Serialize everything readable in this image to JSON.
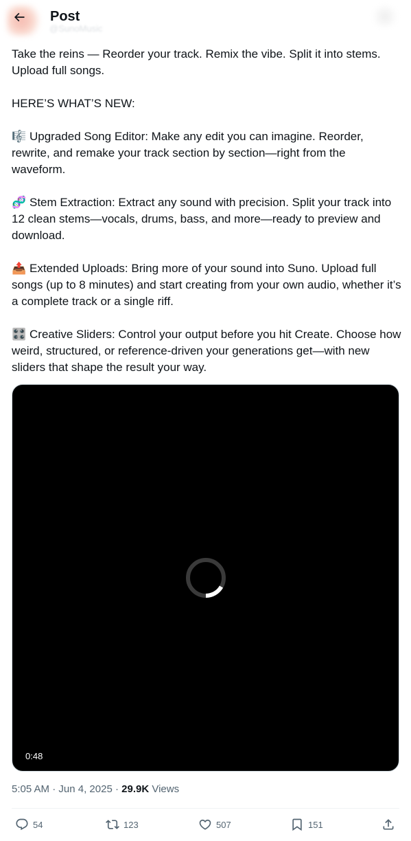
{
  "header": {
    "title": "Post",
    "handle_blur": "@SunoMusic"
  },
  "post": {
    "intro": "Take the reins — Reorder your track. Remix the vibe. Split it into stems. Upload full songs.",
    "heading": "HERE’S WHAT’S NEW:",
    "features": [
      {
        "emoji": "🎼",
        "text": "Upgraded Song Editor: Make any edit you can imagine. Reorder, rewrite, and remake your track section by section—right from the waveform."
      },
      {
        "emoji": "🧬",
        "text": "Stem Extraction: Extract any sound with precision. Split your track into 12 clean stems—vocals, drums, bass, and more—ready to preview and download."
      },
      {
        "emoji": "📤",
        "text": "Extended Uploads: Bring more of your sound into Suno. Upload full songs (up to 8 minutes) and start creating from your own audio, whether it’s a complete track or a single riff."
      },
      {
        "emoji": "🎛️",
        "text": "Creative Sliders: Control your output before you hit Create. Choose how weird, structured, or reference-driven your generations get—with new sliders that shape the result your way."
      }
    ]
  },
  "video": {
    "duration": "0:48"
  },
  "meta": {
    "time": "5:05 AM",
    "sep1": " · ",
    "date": "Jun 4, 2025",
    "sep2": " · ",
    "views_count": "29.9K",
    "views_label": " Views"
  },
  "actions": {
    "replies": "54",
    "reposts": "123",
    "likes": "507",
    "bookmarks": "151"
  },
  "colors": {
    "text": "#0f1419",
    "secondary": "#536471",
    "divider": "#eff3f4",
    "video_bg": "#000000"
  }
}
